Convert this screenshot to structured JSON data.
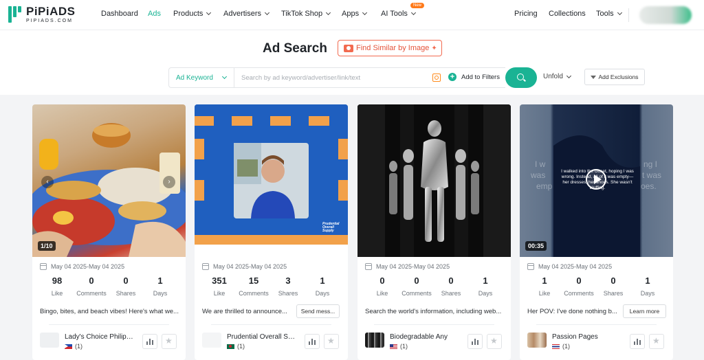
{
  "brand": {
    "name": "PiPiADS",
    "domain": "PIPIADS.COM"
  },
  "nav": {
    "dashboard": "Dashboard",
    "ads": "Ads",
    "products": "Products",
    "advertisers": "Advertisers",
    "tiktok_shop": "TikTok Shop",
    "apps": "Apps",
    "ai_tools": "AI Tools",
    "new_badge": "New",
    "pricing": "Pricing",
    "collections": "Collections",
    "tools": "Tools"
  },
  "search": {
    "title": "Ad Search",
    "find_similar": "Find Similar by Image",
    "keyword_type": "Ad Keyword",
    "placeholder": "Search by ad keyword/advertiser/link/text",
    "add_filters": "Add to Filters",
    "unfold": "Unfold",
    "add_exclusions": "Add Exclusions"
  },
  "stat_labels": {
    "like": "Like",
    "comments": "Comments",
    "shares": "Shares",
    "days": "Days"
  },
  "cards": [
    {
      "badge": "1/10",
      "date": "May 04 2025-May 04 2025",
      "like": "98",
      "comments": "0",
      "shares": "0",
      "days": "1",
      "caption": "Bingo, bites, and beach vibes! Here's what we...",
      "cta": "",
      "advertiser": "Lady's Choice Philippi...",
      "count": "(1)"
    },
    {
      "badge": "",
      "date": "May 04 2025-May 04 2025",
      "like": "351",
      "comments": "15",
      "shares": "3",
      "days": "1",
      "caption": "We are thrilled to announce...",
      "cta": "Send mess...",
      "advertiser": "Prudential Overall Sup...",
      "count": "(1)",
      "logo_text": "Prudential Overall Supply"
    },
    {
      "badge": "",
      "date": "May 04 2025-May 04 2025",
      "like": "0",
      "comments": "0",
      "shares": "0",
      "days": "1",
      "caption": "Search the world's information, including web...",
      "cta": "",
      "advertiser": "Biodegradable Any",
      "count": "(1)"
    },
    {
      "badge": "00:35",
      "date": "May 04 2025-May 04 2025",
      "like": "1",
      "comments": "0",
      "shares": "0",
      "days": "1",
      "caption": "Her POV: I've done nothing b...",
      "cta": "Learn more",
      "advertiser": "Passion Pages",
      "count": "(1)",
      "overlay_text": "I walked into the closet, hoping I was wrong. Instead, all of it was empty—her dresses, her shoes. She wasn't bluffing.",
      "bg_text_1": "I w",
      "bg_text_2": "ng I",
      "bg_text_3": "was",
      "bg_text_4": "t was",
      "bg_text_5": "emp",
      "bg_text_6": "oes."
    }
  ],
  "colors": {
    "brand": "#1ab394",
    "accent_orange": "#f26a4f"
  }
}
